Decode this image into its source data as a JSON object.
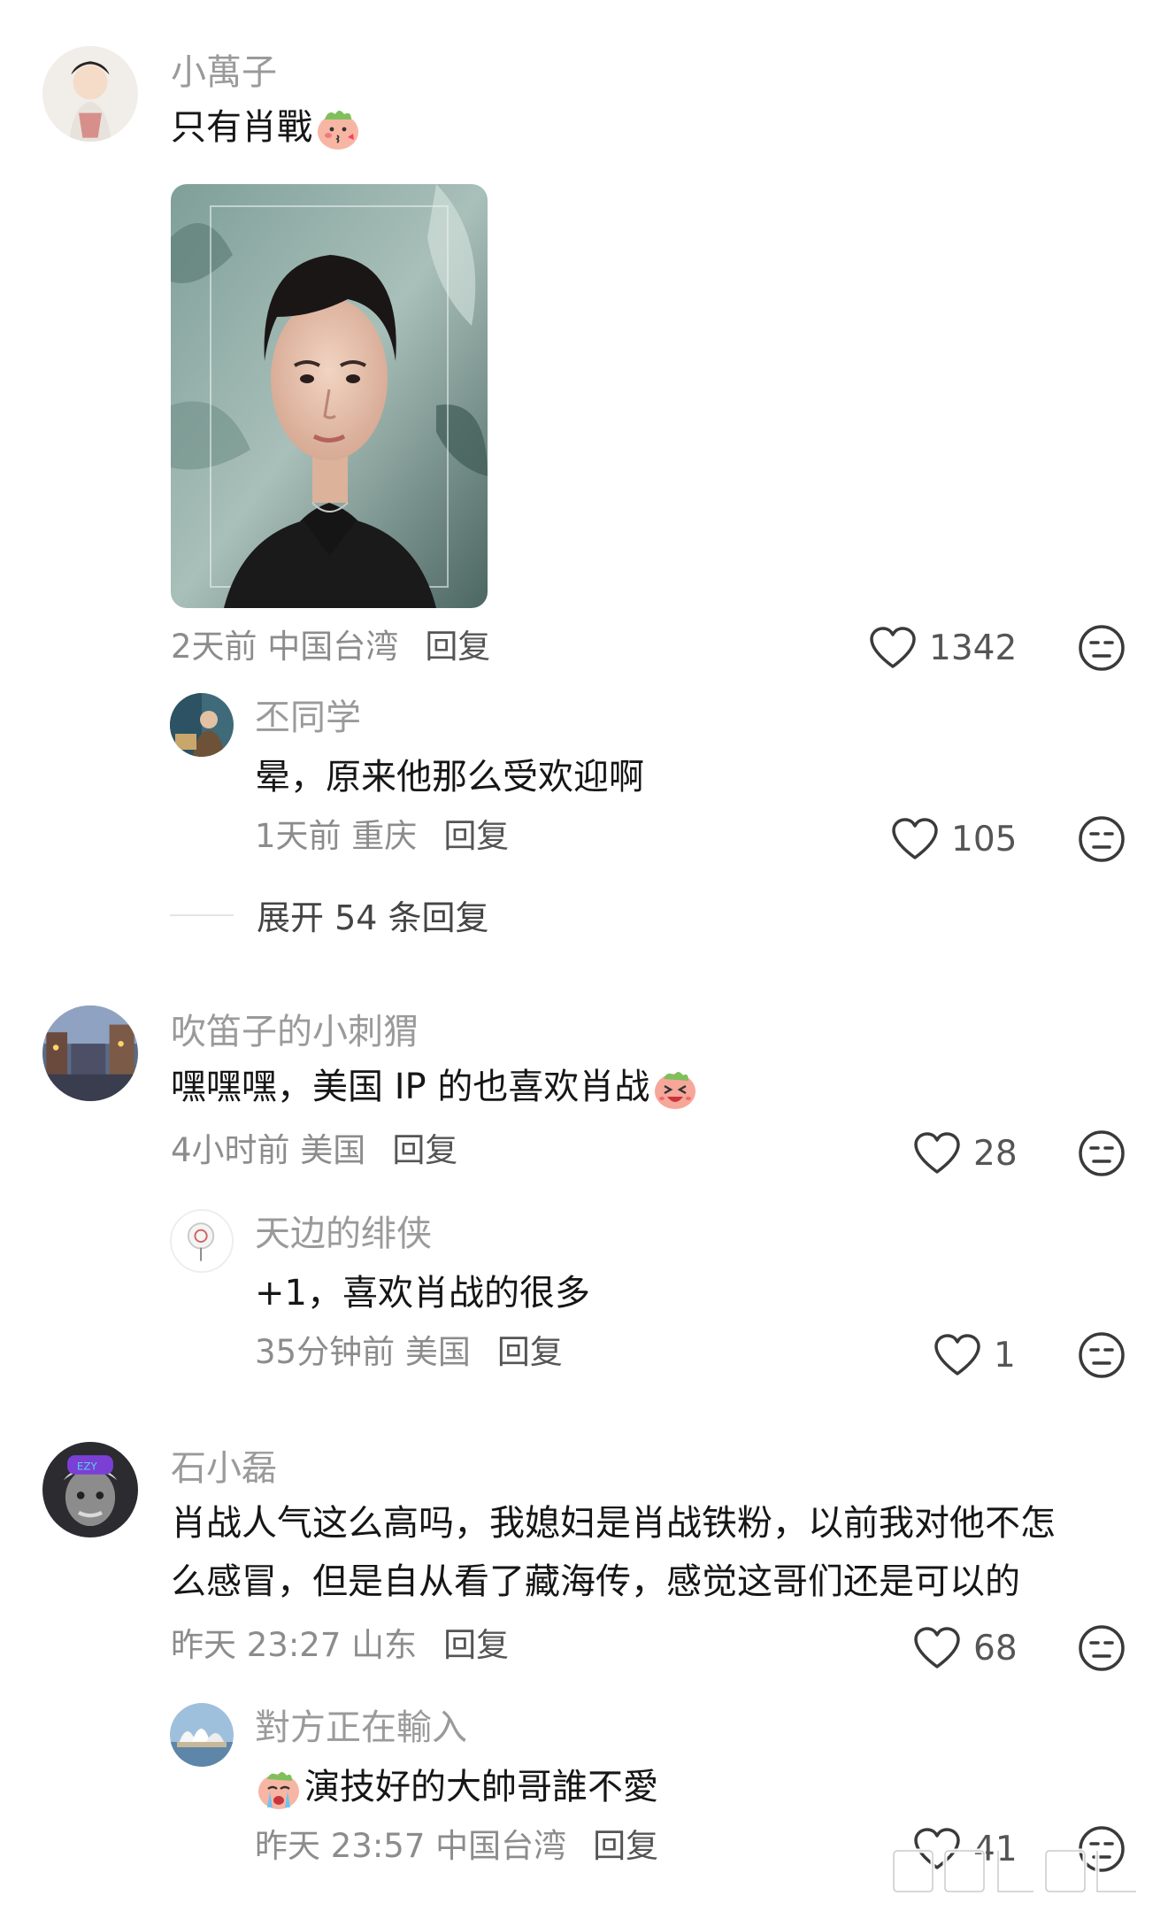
{
  "comments": [
    {
      "username": "小萬子",
      "text": "只有肖戰",
      "emoji": "kiss-face-emoji",
      "meta": "2天前 中国台湾",
      "reply_label": "回复",
      "likes": "1342",
      "replies": [
        {
          "username": "丕同学",
          "text": "晕，原来他那么受欢迎啊",
          "meta": "1天前 重庆",
          "reply_label": "回复",
          "likes": "105"
        }
      ],
      "expand_label": "展开 54 条回复"
    },
    {
      "username": "吹笛子的小刺猬",
      "text": "嘿嘿嘿，美国 IP 的也喜欢肖战",
      "emoji": "laughing-face-emoji",
      "meta": "4小时前 美国",
      "reply_label": "回复",
      "likes": "28",
      "replies": [
        {
          "username": "天边的绯侠",
          "text": "+1，喜欢肖战的很多",
          "meta": "35分钟前 美国",
          "reply_label": "回复",
          "likes": "1"
        }
      ]
    },
    {
      "username": "石小磊",
      "text_line1": "肖战人气这么高吗，我媳妇是肖战铁粉，以前我对他不怎",
      "text_line2": "么感冒，但是自从看了藏海传，感觉这哥们还是可以的",
      "meta": "昨天 23:27 山东",
      "reply_label": "回复",
      "likes": "68",
      "replies": [
        {
          "username": "對方正在輸入",
          "emoji": "crying-face-emoji",
          "text": "演技好的大帥哥誰不愛",
          "meta": "昨天 23:57 中国台湾",
          "reply_label": "回复",
          "likes": "41"
        }
      ]
    }
  ],
  "colors": {
    "username": "#9a9a9a",
    "body_text": "#161616",
    "meta": "#8c8c8c",
    "icon": "#3a3a3a"
  }
}
